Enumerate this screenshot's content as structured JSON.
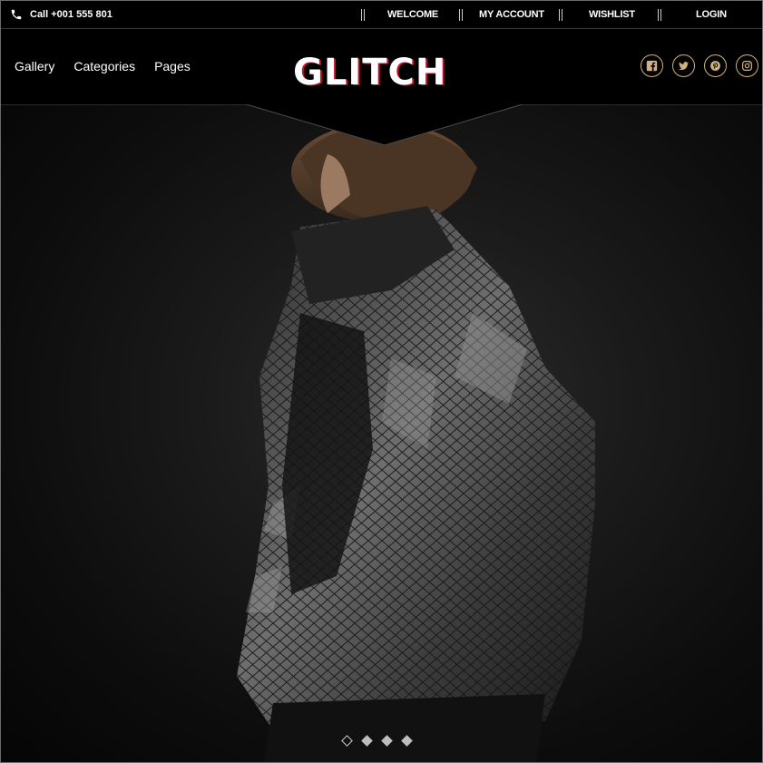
{
  "topbar": {
    "call_text": "Call +001 555 801",
    "links": [
      "WELCOME",
      "MY ACCOUNT",
      "WISHLIST",
      "LOGIN"
    ]
  },
  "header": {
    "nav": [
      "Gallery",
      "Categories",
      "Pages"
    ],
    "logo": "GLITCH",
    "social": [
      "facebook-icon",
      "twitter-icon",
      "pinterest-icon",
      "instagram-icon"
    ]
  },
  "slider": {
    "slides": 4,
    "active_index": 0
  },
  "colors": {
    "accent_gold": "#d1b27f",
    "logo_red": "#c8102e",
    "background": "#000000"
  }
}
